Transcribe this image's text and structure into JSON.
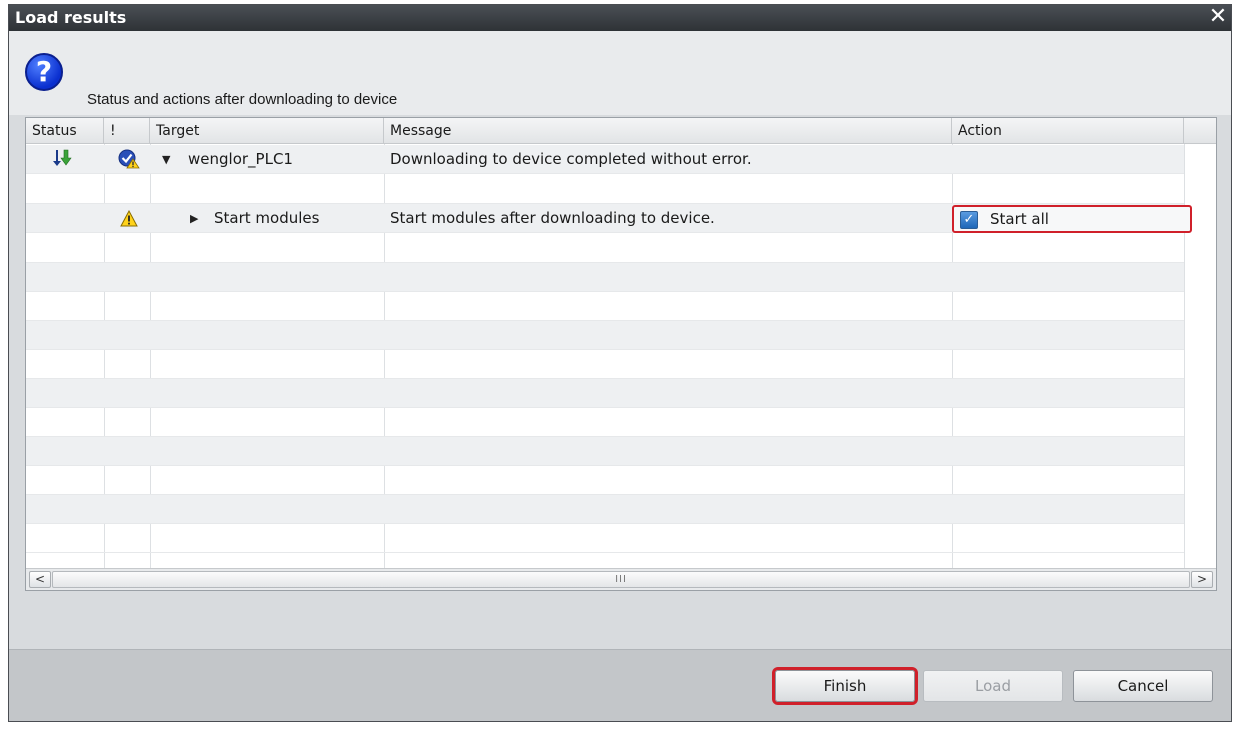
{
  "window": {
    "title": "Load results",
    "close_glyph": "✕"
  },
  "header": {
    "icon": "question-icon",
    "text": "Status and actions after downloading to device"
  },
  "table": {
    "columns": [
      "Status",
      "!",
      "Target",
      "Message",
      "Action"
    ],
    "rows": [
      {
        "status_icon": "download-arrow-icon",
        "alert_icon": "check-warning-icon",
        "expander": "▼",
        "target": "wenglor_PLC1",
        "message": "Downloading to device completed without error.",
        "action": ""
      },
      {
        "status_icon": "",
        "alert_icon": "warning-icon",
        "expander": "▶",
        "target": "Start modules",
        "message": "Start modules after downloading to device.",
        "action": "Start all",
        "action_checked": true
      }
    ]
  },
  "scrollbar": {
    "left_arrow": "<",
    "right_arrow": ">",
    "thumb_grip": "III"
  },
  "footer": {
    "finish_label": "Finish",
    "load_label": "Load",
    "cancel_label": "Cancel"
  },
  "colors": {
    "highlight": "#d0202a",
    "title_bar": "#3a3e43",
    "checkbox": "#1f67b8"
  }
}
